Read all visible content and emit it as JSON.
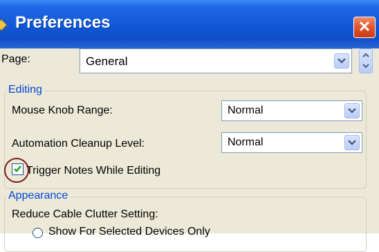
{
  "window": {
    "title": "Preferences",
    "close_label": "✕"
  },
  "page_row": {
    "label": "Page:",
    "selected": "General"
  },
  "editing": {
    "legend": "Editing",
    "mouse_knob_range": {
      "label": "Mouse Knob Range:",
      "value": "Normal"
    },
    "automation_cleanup": {
      "label": "Automation Cleanup Level:",
      "value": "Normal"
    },
    "trigger_notes": {
      "label": "Trigger Notes While Editing",
      "checked": true
    }
  },
  "appearance": {
    "legend": "Appearance",
    "cable_clutter_label": "Reduce Cable Clutter Setting:",
    "option_partial": "Show For Selected Devices Only"
  },
  "colors": {
    "title_bar": "#1157d6",
    "group_legend": "#0046d5",
    "window_bg": "#ece9d8",
    "close_button": "#e1502a"
  }
}
